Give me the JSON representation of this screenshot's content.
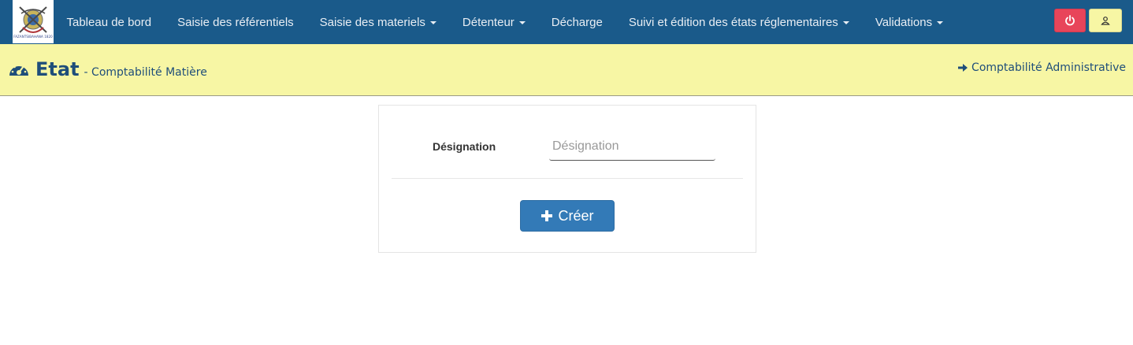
{
  "navbar": {
    "logo_text": "FAZANTSIBAHANA 1820",
    "items": [
      {
        "label": "Tableau de bord",
        "dropdown": false
      },
      {
        "label": "Saisie des référentiels",
        "dropdown": false
      },
      {
        "label": "Saisie des materiels",
        "dropdown": true
      },
      {
        "label": "Détenteur",
        "dropdown": true
      },
      {
        "label": "Décharge",
        "dropdown": false
      },
      {
        "label": "Suivi et édition des états réglementaires",
        "dropdown": true
      },
      {
        "label": "Validations",
        "dropdown": true
      }
    ],
    "power_icon": "power-icon",
    "user_icon": "user-icon",
    "colors": {
      "bar": "#1a5a8a",
      "power": "#e8455a",
      "user": "#f7f6a4"
    }
  },
  "header": {
    "icon": "dashboard-gauge-icon",
    "title": "Etat",
    "subtitle": "- Comptabilité Matière",
    "right_link_icon": "arrow-right-icon",
    "right_link": "Comptabilité Administrative",
    "background": "#f7f6a4"
  },
  "form": {
    "designation_label": "Désignation",
    "designation_value": "",
    "designation_placeholder": "Désignation",
    "create_icon": "plus-icon",
    "create_label": "Créer",
    "button_color": "#337ab7"
  }
}
